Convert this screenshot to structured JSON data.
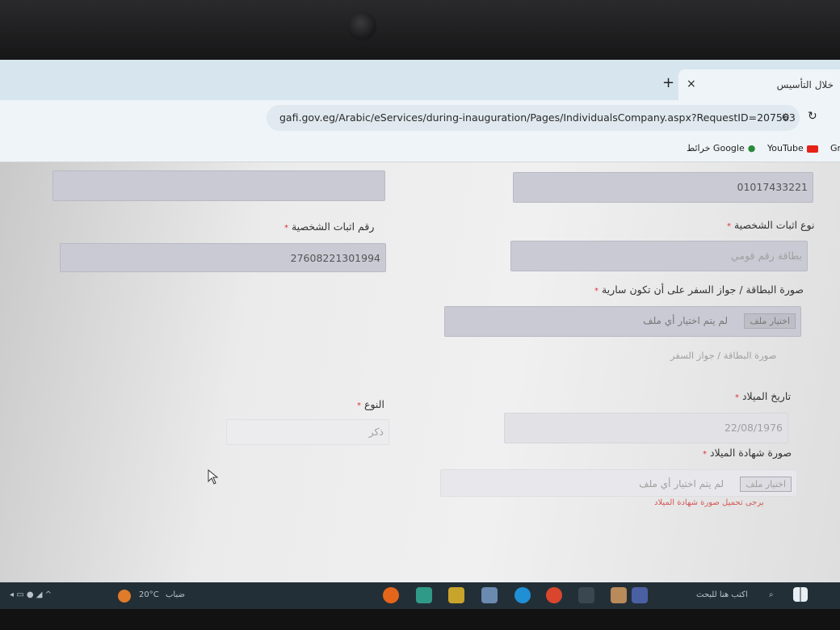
{
  "browser": {
    "tab_title": "خلال التأسيس",
    "tab_close": "×",
    "new_tab": "+",
    "url": "gafi.gov.eg/Arabic/eServices/during-inauguration/Pages/IndividualsCompany.aspx?RequestID=207563",
    "site_settings_icon": "⚙",
    "reload_icon": "↻",
    "bookmarks": {
      "gr": "Gr",
      "youtube": "YouTube",
      "maps": "خرائط Google"
    }
  },
  "form": {
    "phone_value": "01017433221",
    "id_type_label": "نوع اثبات الشخصية",
    "id_type_value": "بطاقة رقم قومي",
    "id_number_label": "رقم اثبات الشخصية",
    "id_number_value": "27608221301994",
    "card_image_label": "صورة البطاقة / جواز السفر على أن تكون سارية",
    "choose_file": "اختيار ملف",
    "no_file": "لم يتم اختيار أي ملف",
    "card_image_hint": "صورة البطاقة / جواز السفر",
    "birth_date_label": "تاريخ الميلاد",
    "birth_date_value": "22/08/1976",
    "gender_label": "النوع",
    "gender_value": "ذكر",
    "birth_cert_label": "صورة شهادة الميلاد",
    "birth_cert_error": "برجى تحميل صورة شهادة الميلاد",
    "required_mark": "*"
  },
  "taskbar": {
    "search_placeholder": "اكتب هنا للبحث",
    "weather_temp": "20°C",
    "weather_desc": "ضباب"
  }
}
